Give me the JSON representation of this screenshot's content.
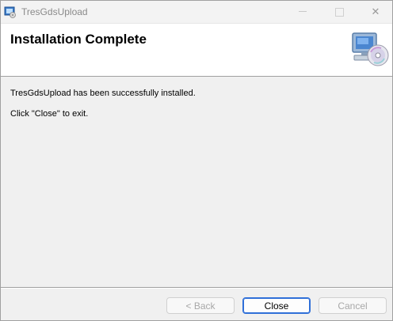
{
  "window": {
    "title": "TresGdsUpload",
    "minimize_icon": "minimize-icon",
    "maximize_icon": "maximize-icon",
    "close_glyph": "✕"
  },
  "header": {
    "title": "Installation Complete",
    "graphic_icon": "computer-with-cd-icon"
  },
  "body": {
    "message1": "TresGdsUpload has been successfully installed.",
    "message2": "Click \"Close\" to exit."
  },
  "buttons": {
    "back": "< Back",
    "close": "Close",
    "cancel": "Cancel"
  }
}
